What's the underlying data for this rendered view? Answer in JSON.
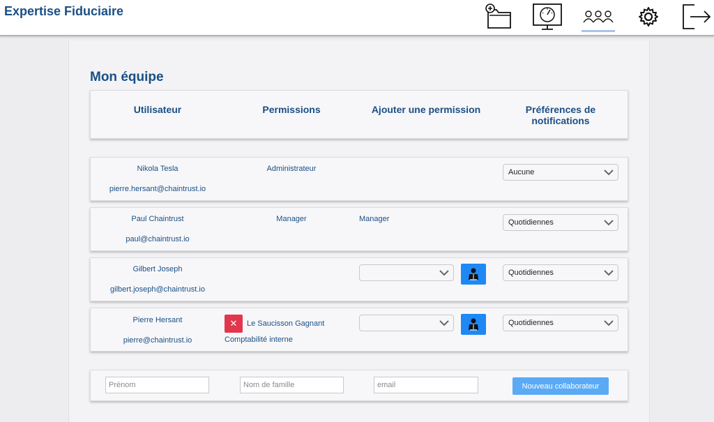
{
  "app": {
    "title": "Expertise Fiduciaire"
  },
  "nav": {
    "items": [
      {
        "icon": "add-folder-icon"
      },
      {
        "icon": "dashboard-monitor-icon"
      },
      {
        "icon": "team-icon",
        "active": true
      },
      {
        "icon": "gear-icon"
      },
      {
        "icon": "logout-icon"
      }
    ]
  },
  "page": {
    "title": "Mon équipe"
  },
  "table": {
    "headers": {
      "user": "Utilisateur",
      "permissions": "Permissions",
      "add_permission": "Ajouter une permission",
      "notif_line1": "Préférences de",
      "notif_line2": "notifications"
    },
    "rows": [
      {
        "name": "Nikola Tesla",
        "email": "pierre.hersant@chaintrust.io",
        "permission": "Administrateur",
        "notification": "Aucune"
      },
      {
        "name": "Paul Chaintrust",
        "email": "paul@chaintrust.io",
        "permission": "Manager",
        "add_permission_text": "Manager",
        "notification": "Quotidiennes"
      },
      {
        "name": "Gilbert Joseph",
        "email": "gilbert.joseph@chaintrust.io",
        "add_permission_select": "",
        "notification": "Quotidiennes"
      },
      {
        "name": "Pierre Hersant",
        "email": "pierre@chaintrust.io",
        "permission_company": "Le Saucisson Gagnant",
        "permission_role": "Comptabilité interne",
        "add_permission_select": "",
        "notification": "Quotidiennes"
      }
    ]
  },
  "new_member_form": {
    "firstname_placeholder": "Prénom",
    "lastname_placeholder": "Nom de famille",
    "email_placeholder": "email",
    "submit_label": "Nouveau collaborateur"
  },
  "colors": {
    "brand": "#1a4f85",
    "primary_button": "#1e88f5",
    "submit_button": "#5aaaf6",
    "danger": "#e2364d"
  }
}
